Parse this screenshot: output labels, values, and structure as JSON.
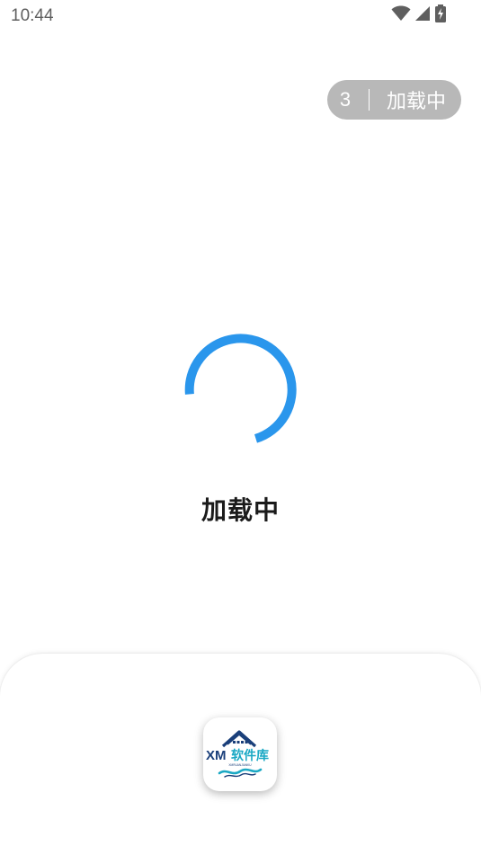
{
  "status_bar": {
    "time": "10:44"
  },
  "skip": {
    "count": "3",
    "label": "加载中"
  },
  "loading": {
    "text": "加载中",
    "spinner_color": "#2a96ec"
  },
  "app_icon": {
    "brand_text": "XM软件库",
    "brand_sub": "XMRUANJIANKU",
    "colors": {
      "dark_blue": "#1a3f7a",
      "teal": "#1aa8c4"
    }
  }
}
